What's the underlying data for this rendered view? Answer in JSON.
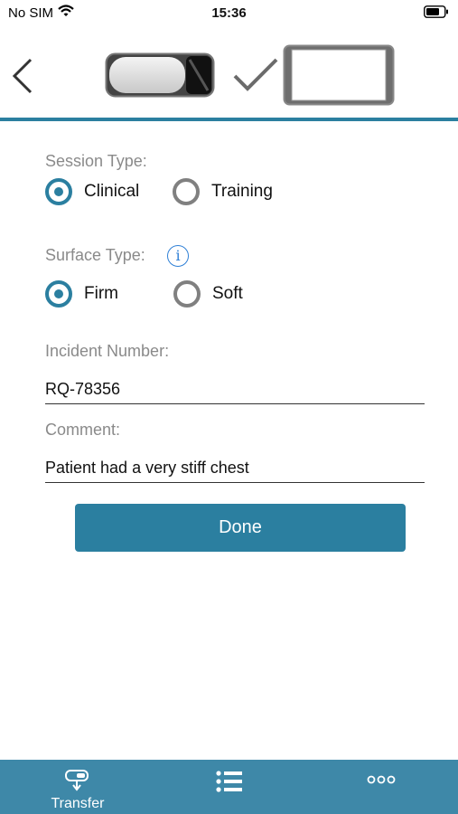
{
  "status_bar": {
    "carrier": "No SIM",
    "time": "15:36"
  },
  "toolbar": {
    "back_icon": "chevron-left-icon",
    "device_toggle_icon": "toggle-device-icon",
    "check_icon": "checkmark-icon",
    "screen_icon": "screen-device-icon"
  },
  "form": {
    "session_type": {
      "label": "Session Type:",
      "options": [
        "Clinical",
        "Training"
      ],
      "selected": "Clinical"
    },
    "surface_type": {
      "label": "Surface Type:",
      "options": [
        "Firm",
        "Soft"
      ],
      "selected": "Firm",
      "info_icon": "info-icon"
    },
    "incident_number": {
      "label": "Incident Number:",
      "value": "RQ-78356"
    },
    "comment": {
      "label": "Comment:",
      "value": "Patient had a very stiff chest"
    },
    "done_label": "Done"
  },
  "tab_bar": {
    "tabs": [
      {
        "label": "Transfer",
        "icon": "transfer-icon"
      },
      {
        "label": "",
        "icon": "list-icon"
      },
      {
        "label": "",
        "icon": "more-icon"
      }
    ]
  },
  "colors": {
    "accent": "#2b7fa0",
    "tab_bar": "#3e88a8",
    "label_gray": "#8a8a8a",
    "info_blue": "#2f80d6"
  }
}
